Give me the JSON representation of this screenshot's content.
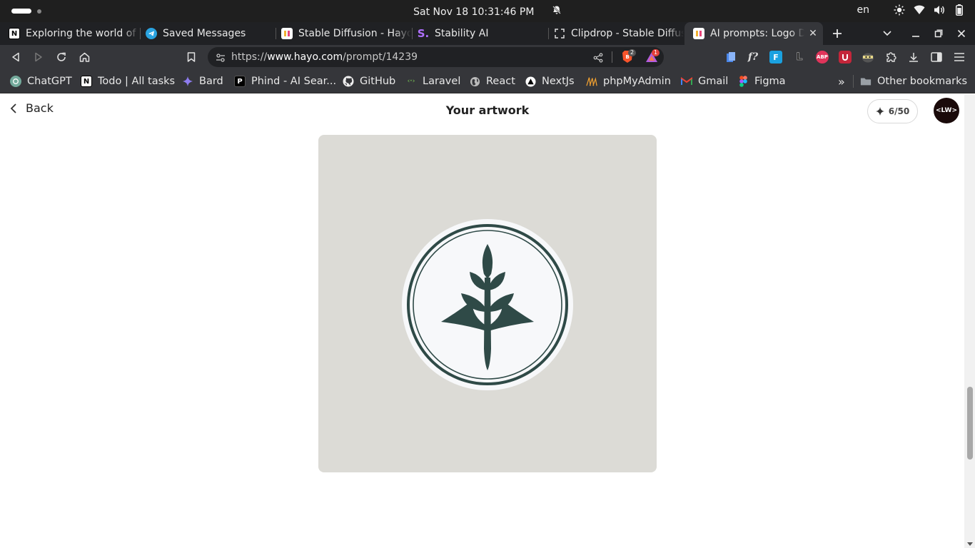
{
  "system_bar": {
    "datetime": "Sat Nov 18  10:31:46 PM",
    "language": "en",
    "icons": [
      "notification-bell-icon",
      "brightness-icon",
      "wifi-icon",
      "volume-icon",
      "battery-icon"
    ]
  },
  "tabs": [
    {
      "title": "Exploring the world of",
      "favicon": "notion-icon",
      "active": false
    },
    {
      "title": "Saved Messages",
      "favicon": "telegram-icon",
      "active": false
    },
    {
      "title": "Stable Diffusion - Hayo",
      "favicon": "hayo-icon",
      "active": false
    },
    {
      "title": "Stability AI",
      "favicon": "stability-icon",
      "active": false
    },
    {
      "title": "Clipdrop - Stable Diffus",
      "favicon": "clipdrop-icon",
      "active": false
    },
    {
      "title": "AI prompts: Logo D",
      "favicon": "hayo-icon",
      "active": true
    }
  ],
  "address_bar": {
    "url_prefix": "https://",
    "url_host": "www.hayo.com",
    "url_path": "/prompt/14239",
    "brave_shield_count": "2",
    "rewards_count": "1"
  },
  "bookmarks": [
    {
      "label": "ChatGPT",
      "icon": "chatgpt-icon"
    },
    {
      "label": "Todo | All tasks",
      "icon": "notion-icon"
    },
    {
      "label": "Bard",
      "icon": "bard-icon"
    },
    {
      "label": "Phind - AI Sear...",
      "icon": "phind-icon"
    },
    {
      "label": "GitHub",
      "icon": "github-icon"
    },
    {
      "label": "Laravel",
      "icon": "laravel-icon"
    },
    {
      "label": "React",
      "icon": "globe-icon"
    },
    {
      "label": "NextJs",
      "icon": "nextjs-icon"
    },
    {
      "label": "phpMyAdmin",
      "icon": "phpmyadmin-icon"
    },
    {
      "label": "Gmail",
      "icon": "gmail-icon"
    },
    {
      "label": "Figma",
      "icon": "figma-icon"
    }
  ],
  "other_bookmarks": "Other bookmarks",
  "extensions": {
    "abp_label": "ABP",
    "figma_label": "F",
    "font_label": "f?",
    "letter_label": "L"
  },
  "page": {
    "back_label": "Back",
    "title": "Your artwork",
    "credits": "6/50",
    "avatar_text": "<LW>"
  },
  "colors": {
    "artwork_bg": "#dcdbd6",
    "logo_green": "#2f4a47",
    "logo_bg": "#f7f8fa"
  }
}
